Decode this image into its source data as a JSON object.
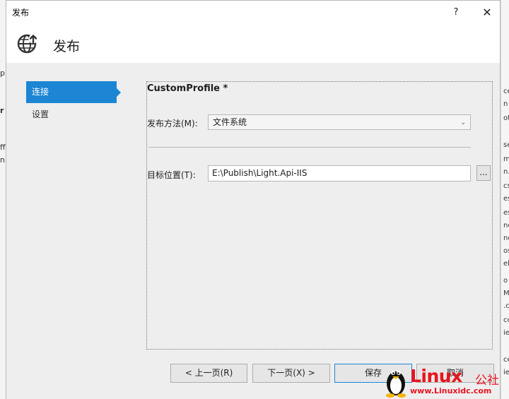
{
  "background_fragments": {
    "left": [
      "p",
      "r",
      "ff",
      "n"
    ],
    "right": [
      "ce",
      "n",
      "ot",
      "se",
      "m",
      "n.",
      "cs",
      "es",
      "es",
      "ne",
      "ne",
      "os",
      "el",
      "o",
      "M",
      ".c",
      "cc",
      "ie",
      "ce",
      "ie"
    ]
  },
  "dialog": {
    "title": "发布",
    "help_glyph": "?",
    "close_glyph": "✕"
  },
  "header": {
    "title": "发布",
    "icon": "globe-publish-icon"
  },
  "nav": {
    "items": [
      {
        "label": "连接",
        "active": true
      },
      {
        "label": "设置",
        "active": false
      }
    ]
  },
  "connection": {
    "profile_name": "CustomProfile *",
    "method_label": "发布方法(M):",
    "method_value": "文件系统",
    "target_label": "目标位置(T):",
    "target_value": "E:\\Publish\\Light.Api-IIS",
    "browse_label": "..."
  },
  "buttons": {
    "prev": "< 上一页(R)",
    "next": "下一页(X) >",
    "save": "保存",
    "cancel": "取消"
  },
  "watermark": {
    "brand": "Linux",
    "brand_cn": "公社",
    "url": "www.Linuxidc.com"
  },
  "colors": {
    "accent": "#1c86d4",
    "panel_bg": "#eeeeef",
    "watermark": "#e8141e"
  }
}
